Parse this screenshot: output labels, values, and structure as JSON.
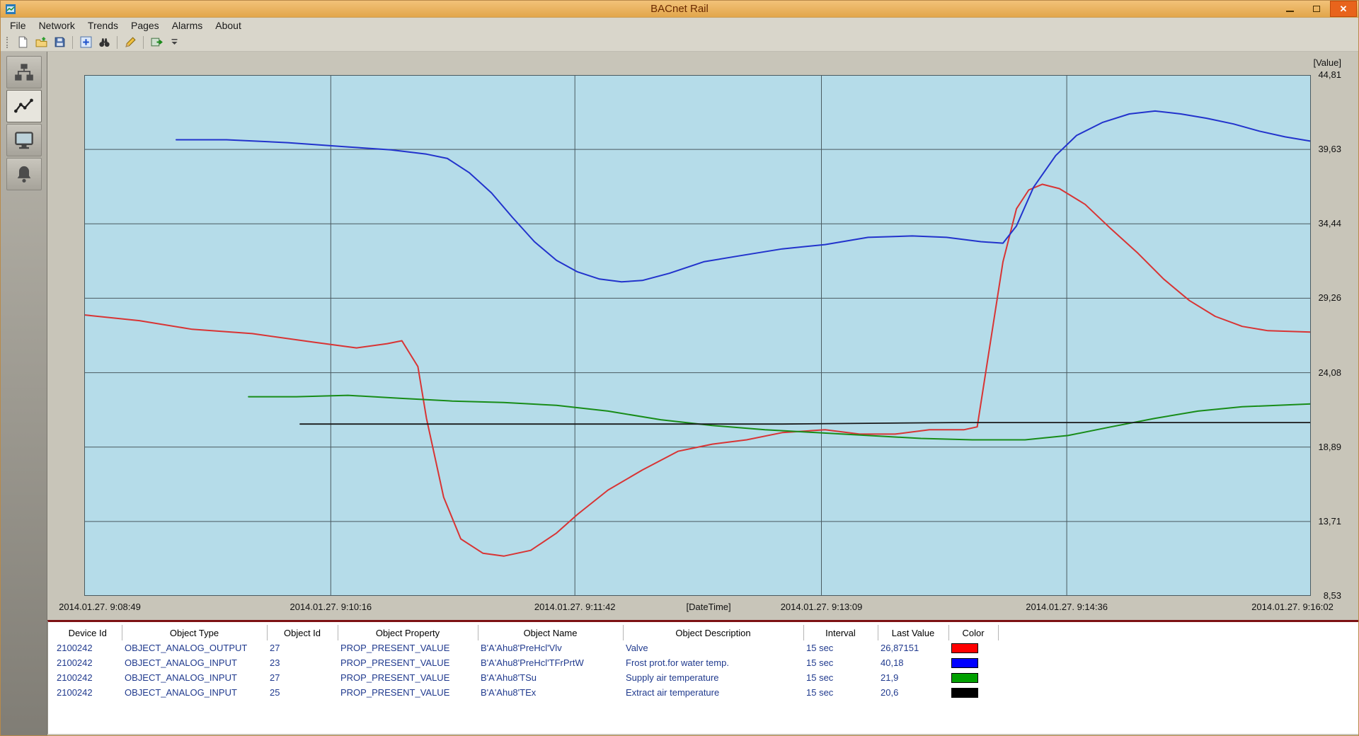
{
  "window": {
    "title": "BACnet Rail",
    "close_glyph": "✕",
    "buttons": [
      "minimize",
      "maximize",
      "close"
    ]
  },
  "menu": {
    "items": [
      "File",
      "Network",
      "Trends",
      "Pages",
      "Alarms",
      "About"
    ]
  },
  "toolbar": {
    "buttons": [
      "new-document",
      "open",
      "save",
      "add-trend",
      "find",
      "edit-pen",
      "export-report"
    ]
  },
  "sidebar": {
    "buttons": [
      {
        "name": "network-tree",
        "selected": false
      },
      {
        "name": "trends",
        "selected": true
      },
      {
        "name": "pages",
        "selected": false
      },
      {
        "name": "alarms",
        "selected": false
      }
    ]
  },
  "chart_data": {
    "type": "line",
    "title": "",
    "ylabel": "[Value]",
    "xlabel": "[DateTime]",
    "plot_background": "#b5dce9",
    "grid_color": "#4a5a60",
    "y_range": [
      8.53,
      44.81
    ],
    "y_ticks": [
      "44,81",
      "39,63",
      "34,44",
      "29,26",
      "24,08",
      "18,89",
      "13,71",
      "8,53"
    ],
    "x_ticks": [
      "2014.01.27. 9:08:49",
      "2014.01.27. 9:10:16",
      "2014.01.27. 9:11:42",
      "2014.01.27. 9:13:09",
      "2014.01.27. 9:14:36",
      "2014.01.27. 9:16:02"
    ],
    "x_tick_fracs": [
      0,
      0.201,
      0.4,
      0.601,
      0.801,
      1.0
    ],
    "xlabel_frac": 0.509,
    "legend_position": "table-below",
    "grid": true,
    "series": [
      {
        "id": "valve",
        "name": "Valve",
        "color": "#d83434",
        "width": 2,
        "points": [
          [
            0.0,
            28.1
          ],
          [
            0.045,
            27.7
          ],
          [
            0.088,
            27.1
          ],
          [
            0.137,
            26.8
          ],
          [
            0.187,
            26.2
          ],
          [
            0.222,
            25.8
          ],
          [
            0.247,
            26.1
          ],
          [
            0.259,
            26.3
          ],
          [
            0.272,
            24.5
          ],
          [
            0.279,
            20.9
          ],
          [
            0.293,
            15.4
          ],
          [
            0.307,
            12.5
          ],
          [
            0.325,
            11.5
          ],
          [
            0.342,
            11.3
          ],
          [
            0.364,
            11.7
          ],
          [
            0.385,
            12.9
          ],
          [
            0.402,
            14.2
          ],
          [
            0.427,
            15.9
          ],
          [
            0.455,
            17.3
          ],
          [
            0.484,
            18.6
          ],
          [
            0.512,
            19.1
          ],
          [
            0.54,
            19.4
          ],
          [
            0.569,
            19.9
          ],
          [
            0.604,
            20.1
          ],
          [
            0.632,
            19.8
          ],
          [
            0.661,
            19.8
          ],
          [
            0.689,
            20.1
          ],
          [
            0.717,
            20.1
          ],
          [
            0.728,
            20.3
          ],
          [
            0.738,
            25.8
          ],
          [
            0.749,
            31.8
          ],
          [
            0.76,
            35.5
          ],
          [
            0.77,
            36.8
          ],
          [
            0.781,
            37.2
          ],
          [
            0.795,
            36.9
          ],
          [
            0.816,
            35.8
          ],
          [
            0.837,
            34.1
          ],
          [
            0.859,
            32.4
          ],
          [
            0.88,
            30.6
          ],
          [
            0.901,
            29.1
          ],
          [
            0.922,
            28.0
          ],
          [
            0.944,
            27.3
          ],
          [
            0.965,
            27.0
          ],
          [
            1.0,
            26.9
          ]
        ]
      },
      {
        "id": "frost-protection",
        "name": "Frost prot.for water temp.",
        "color": "#2233cc",
        "width": 2,
        "points": [
          [
            0.075,
            40.3
          ],
          [
            0.116,
            40.3
          ],
          [
            0.166,
            40.1
          ],
          [
            0.215,
            39.8
          ],
          [
            0.25,
            39.6
          ],
          [
            0.279,
            39.3
          ],
          [
            0.296,
            39.0
          ],
          [
            0.314,
            38.0
          ],
          [
            0.332,
            36.6
          ],
          [
            0.349,
            34.9
          ],
          [
            0.367,
            33.2
          ],
          [
            0.385,
            31.9
          ],
          [
            0.402,
            31.1
          ],
          [
            0.42,
            30.6
          ],
          [
            0.438,
            30.4
          ],
          [
            0.455,
            30.5
          ],
          [
            0.477,
            31.0
          ],
          [
            0.505,
            31.8
          ],
          [
            0.533,
            32.2
          ],
          [
            0.569,
            32.7
          ],
          [
            0.604,
            33.0
          ],
          [
            0.639,
            33.5
          ],
          [
            0.675,
            33.6
          ],
          [
            0.703,
            33.5
          ],
          [
            0.731,
            33.2
          ],
          [
            0.749,
            33.1
          ],
          [
            0.76,
            34.3
          ],
          [
            0.774,
            37.0
          ],
          [
            0.792,
            39.2
          ],
          [
            0.809,
            40.6
          ],
          [
            0.83,
            41.5
          ],
          [
            0.852,
            42.1
          ],
          [
            0.873,
            42.3
          ],
          [
            0.894,
            42.1
          ],
          [
            0.915,
            41.8
          ],
          [
            0.937,
            41.4
          ],
          [
            0.958,
            40.9
          ],
          [
            0.979,
            40.5
          ],
          [
            1.0,
            40.2
          ]
        ]
      },
      {
        "id": "supply-air-temp",
        "name": "Supply air temperature",
        "color": "#188c18",
        "width": 2,
        "points": [
          [
            0.134,
            22.4
          ],
          [
            0.173,
            22.4
          ],
          [
            0.215,
            22.5
          ],
          [
            0.257,
            22.3
          ],
          [
            0.3,
            22.1
          ],
          [
            0.342,
            22.0
          ],
          [
            0.385,
            21.8
          ],
          [
            0.427,
            21.4
          ],
          [
            0.47,
            20.8
          ],
          [
            0.512,
            20.4
          ],
          [
            0.555,
            20.1
          ],
          [
            0.597,
            19.9
          ],
          [
            0.639,
            19.7
          ],
          [
            0.682,
            19.5
          ],
          [
            0.724,
            19.4
          ],
          [
            0.767,
            19.4
          ],
          [
            0.802,
            19.7
          ],
          [
            0.837,
            20.3
          ],
          [
            0.873,
            20.9
          ],
          [
            0.908,
            21.4
          ],
          [
            0.944,
            21.7
          ],
          [
            1.0,
            21.9
          ]
        ]
      },
      {
        "id": "extract-air-temp",
        "name": "Extract air temperature",
        "color": "#1a1a1a",
        "width": 1.8,
        "points": [
          [
            0.176,
            20.5
          ],
          [
            0.3,
            20.5
          ],
          [
            0.427,
            20.5
          ],
          [
            0.569,
            20.5
          ],
          [
            0.71,
            20.6
          ],
          [
            0.852,
            20.6
          ],
          [
            1.0,
            20.6
          ]
        ]
      }
    ]
  },
  "table": {
    "columns": [
      "Device Id",
      "Object Type",
      "Object Id",
      "Object Property",
      "Object Name",
      "Object Description",
      "Interval",
      "Last Value",
      "Color"
    ],
    "rows": [
      {
        "cells": [
          "2100242",
          "OBJECT_ANALOG_OUTPUT",
          "27",
          "PROP_PRESENT_VALUE",
          "B'A'Ahu8'PreHcl'Vlv",
          "Valve",
          "15 sec",
          "26,87151"
        ],
        "color": "#ff0000"
      },
      {
        "cells": [
          "2100242",
          "OBJECT_ANALOG_INPUT",
          "23",
          "PROP_PRESENT_VALUE",
          "B'A'Ahu8'PreHcl'TFrPrtW",
          "Frost prot.for water temp.",
          "15 sec",
          "40,18"
        ],
        "color": "#0000ff"
      },
      {
        "cells": [
          "2100242",
          "OBJECT_ANALOG_INPUT",
          "27",
          "PROP_PRESENT_VALUE",
          "B'A'Ahu8'TSu",
          "Supply air temperature",
          "15 sec",
          "21,9"
        ],
        "color": "#00a000"
      },
      {
        "cells": [
          "2100242",
          "OBJECT_ANALOG_INPUT",
          "25",
          "PROP_PRESENT_VALUE",
          "B'A'Ahu8'TEx",
          "Extract air temperature",
          "15 sec",
          "20,6"
        ],
        "color": "#000000"
      }
    ]
  }
}
